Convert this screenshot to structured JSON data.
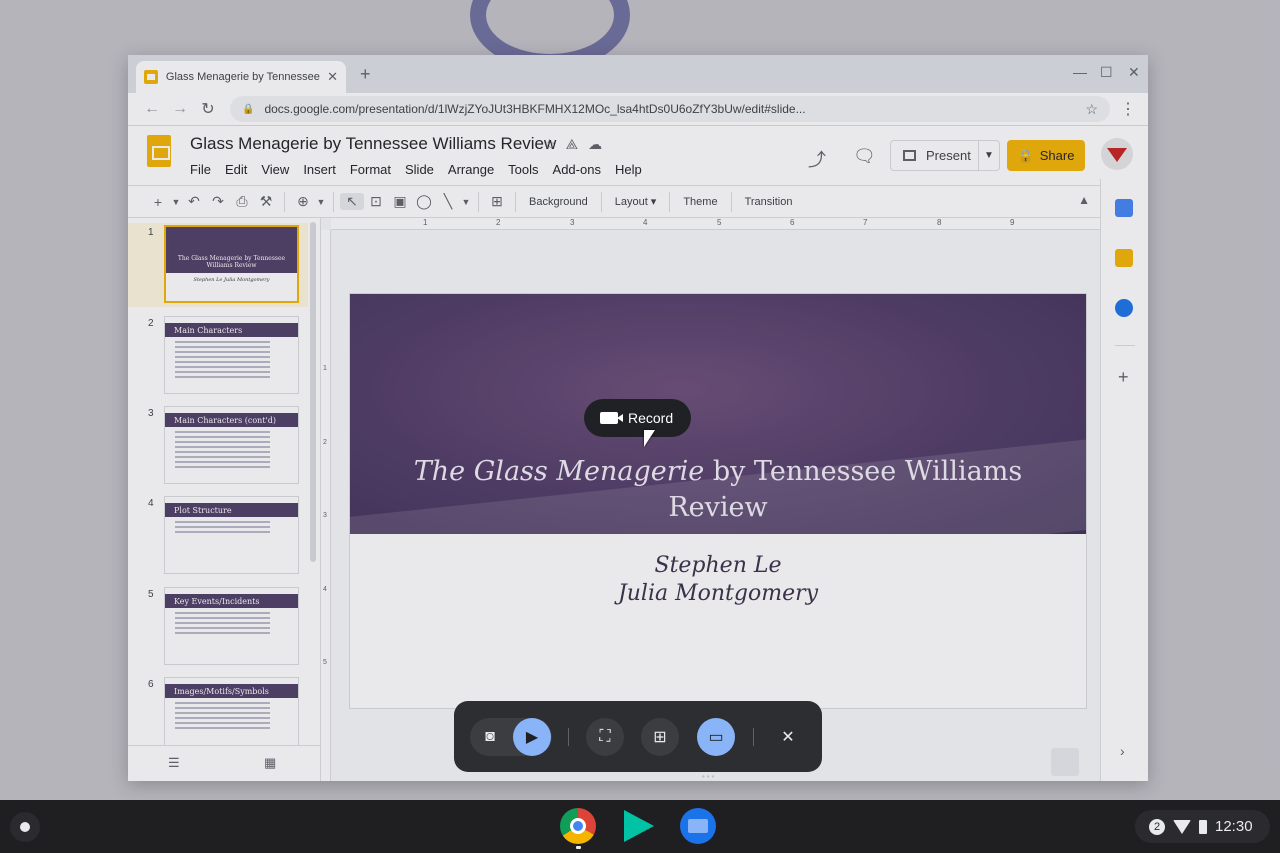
{
  "browser": {
    "tab_title": "Glass Menagerie by Tennessee W",
    "tab_close": "✕",
    "new_tab": "+",
    "url": "docs.google.com/presentation/d/1lWzjZYoJUt3HBKFMHX12MOc_lsa4htDs0U6oZfY3bUw/edit#slide..."
  },
  "doc": {
    "title": "Glass Menagerie by Tennessee Williams Review",
    "menu": [
      "File",
      "Edit",
      "View",
      "Insert",
      "Format",
      "Slide",
      "Arrange",
      "Tools",
      "Add-ons",
      "Help"
    ],
    "present_label": "Present",
    "share_label": "Share"
  },
  "toolbar": {
    "background": "Background",
    "layout": "Layout",
    "theme": "Theme",
    "transition": "Transition"
  },
  "ruler": [
    "1",
    "2",
    "3",
    "4",
    "5",
    "6",
    "7",
    "8",
    "9"
  ],
  "ruler_v": [
    "1",
    "2",
    "3",
    "4",
    "5"
  ],
  "slides": [
    {
      "num": "1",
      "title": "The Glass Menagerie by Tennessee Williams Review",
      "subtitle": "Stephen Le Julia Montgomery"
    },
    {
      "num": "2",
      "title": "Main Characters"
    },
    {
      "num": "3",
      "title": "Main Characters (cont'd)"
    },
    {
      "num": "4",
      "title": "Plot Structure"
    },
    {
      "num": "5",
      "title": "Key Events/Incidents"
    },
    {
      "num": "6",
      "title": "Images/Motifs/Symbols"
    }
  ],
  "current_slide": {
    "title_italic": "The Glass Menagerie",
    "title_rest": " by Tennessee Williams Review",
    "author1": "Stephen Le",
    "author2": "Julia Montgomery"
  },
  "record": {
    "label": "Record"
  },
  "tray": {
    "notifications": "2",
    "time": "12:30"
  },
  "colors": {
    "accent": "#f4b400",
    "slide_purple": "#4f3a66",
    "capture_active": "#8ab4f8"
  }
}
